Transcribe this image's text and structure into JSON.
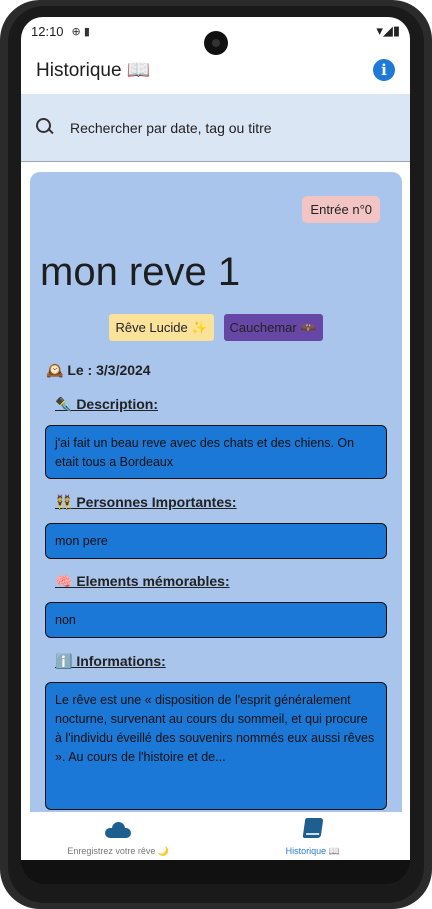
{
  "status_bar": {
    "time": "12:10",
    "indicators": "⊕ ▮",
    "signal": "▾◢▮"
  },
  "app_bar": {
    "title": "Historique 📖",
    "info_icon": "i"
  },
  "search": {
    "placeholder": "Rechercher par date, tag ou titre"
  },
  "entry": {
    "badge": "Entrée n°0",
    "title": "mon reve 1",
    "tags": [
      "Rêve Lucide ✨",
      "Cauchemar 🦇"
    ],
    "date_label": "🕰️ Le : 3/3/2024",
    "description_label": "✒️ Description:",
    "description": "j'ai fait un beau reve avec des chats et des chiens. On etait tous a Bordeaux",
    "people_label": "👯 Personnes Importantes:",
    "people": "mon pere",
    "elements_label": "🧠 Elements mémorables: ",
    "elements": "non",
    "info_label": "ℹ️ Informations:",
    "info": "Le rêve est une « disposition de l'esprit généralement nocturne, survenant au cours du sommeil, et qui procure à l'individu éveillé des souvenirs nommés eux aussi rêves ». Au cours de l'histoire et de..."
  },
  "bottom_nav": {
    "items": [
      {
        "label": "Enregistrez votre rêve 🌙",
        "icon": "cloud-icon"
      },
      {
        "label": "Historique 📖",
        "icon": "book-icon"
      }
    ]
  },
  "colors": {
    "card": "#a9c5ec",
    "field": "#1b78d6",
    "search_bg": "#dbe6f5",
    "accent": "#2a7bd0",
    "tag_lucid": "#fae29a",
    "tag_nightmare": "#6747a6",
    "badge": "#f2c4c4"
  }
}
